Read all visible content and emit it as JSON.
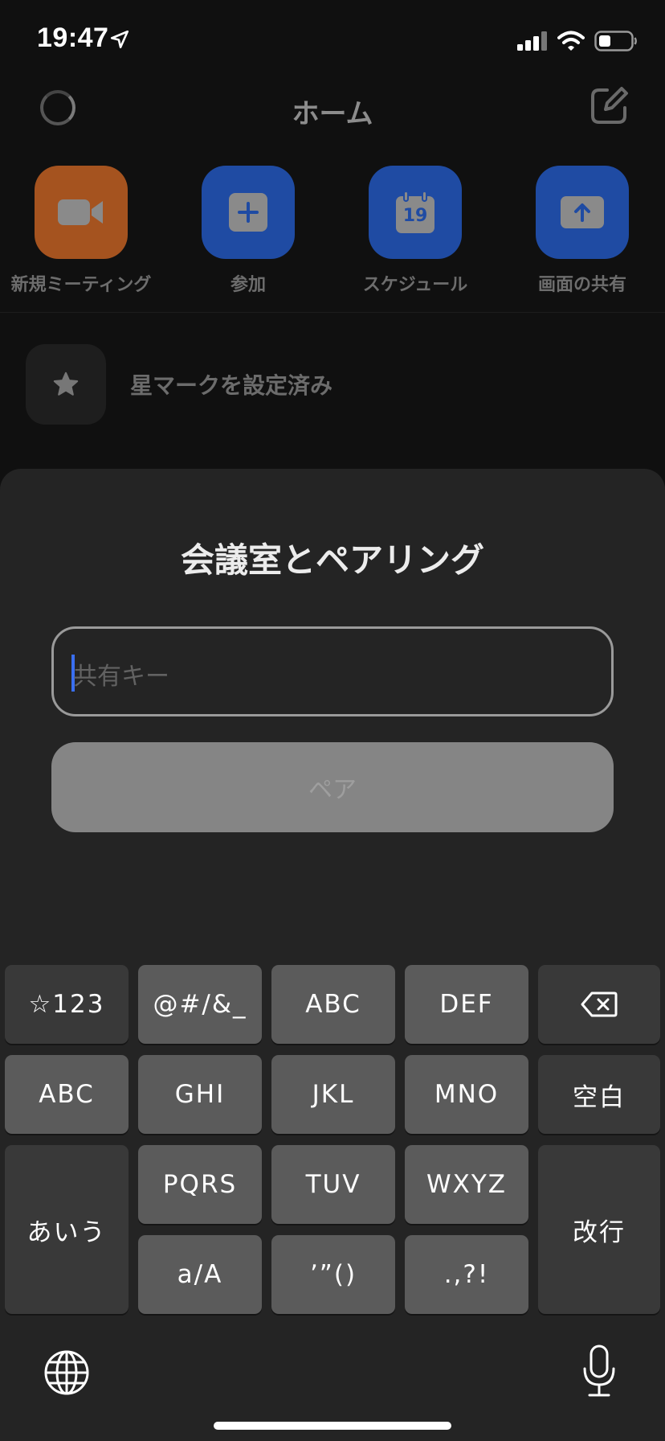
{
  "status_bar": {
    "time": "19:47"
  },
  "nav": {
    "title": "ホーム"
  },
  "actions": [
    {
      "label": "新規ミーティング",
      "color": "#b35a28",
      "icon": "video-camera-icon"
    },
    {
      "label": "参加",
      "color": "#2457b8",
      "icon": "plus-icon"
    },
    {
      "label": "スケジュール",
      "color": "#2457b8",
      "icon": "calendar-icon",
      "calendar_day": "19"
    },
    {
      "label": "画面の共有",
      "color": "#2457b8",
      "icon": "share-screen-icon"
    }
  ],
  "starred": {
    "label": "星マークを設定済み"
  },
  "sheet": {
    "title": "会議室とペアリング",
    "input_placeholder": "共有キー",
    "input_value": "",
    "pair_button_label": "ペア"
  },
  "keyboard": {
    "rows": {
      "r1": [
        "☆123",
        "@#/&_",
        "ABC",
        "DEF"
      ],
      "r2": [
        "ABC",
        "GHI",
        "JKL",
        "MNO",
        "空白"
      ],
      "r3": [
        "あいう",
        "PQRS",
        "TUV",
        "WXYZ",
        "改行"
      ],
      "r4": [
        "a/A",
        "’”()",
        ".,?!"
      ]
    }
  }
}
